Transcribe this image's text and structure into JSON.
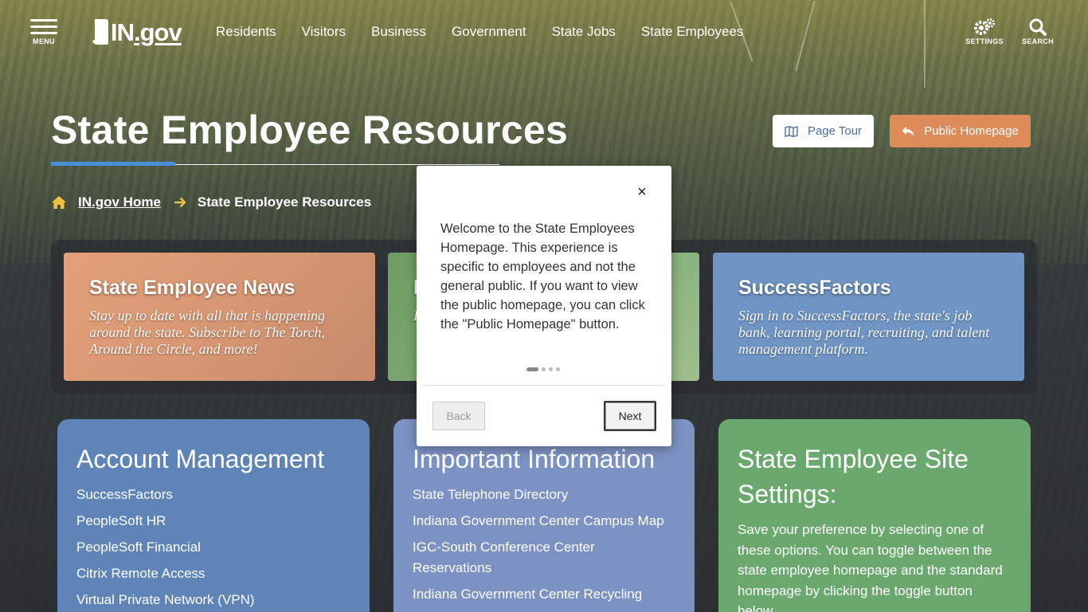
{
  "header": {
    "menu_label": "MENU",
    "logo_text_in": "IN",
    "logo_text_gov": ".gov",
    "nav": [
      "Residents",
      "Visitors",
      "Business",
      "Government",
      "State Jobs",
      "State Employees"
    ],
    "settings_label": "SETTINGS",
    "search_label": "SEARCH"
  },
  "hero": {
    "title": "State Employee Resources",
    "page_tour_label": "Page Tour",
    "public_homepage_label": "Public Homepage"
  },
  "breadcrumb": {
    "home": "IN.gov Home",
    "current": "State Employee Resources"
  },
  "features": [
    {
      "title": "State Employee News",
      "desc": "Stay up to date with all that is happening around the state. Subscribe to The Torch, Around the Circle, and more!"
    },
    {
      "title": "I",
      "desc": "L"
    },
    {
      "title": "SuccessFactors",
      "desc": "Sign in to SuccessFactors, the state's job bank, learning portal, recruiting, and talent management platform."
    }
  ],
  "account": {
    "title": "Account Management",
    "links": [
      "SuccessFactors",
      "PeopleSoft HR",
      "PeopleSoft Financial",
      "Citrix Remote Access",
      "Virtual Private Network (VPN)"
    ]
  },
  "important": {
    "title": "Important Information",
    "links": [
      "State Telephone Directory",
      "Indiana Government Center Campus Map",
      "IGC-South Conference Center Reservations",
      "Indiana Government Center Recycling"
    ]
  },
  "settings_card": {
    "title": "State Employee Site Settings:",
    "body": "Save your preference by selecting one of these options. You can toggle between the state employee homepage and the standard homepage by clicking the toggle button below."
  },
  "tour": {
    "close_glyph": "×",
    "text": "Welcome to the State Employees Homepage. This experience is specific to employees and not the general public. If you want to view the public homepage, you can click the \"Public Homepage\" button.",
    "back_label": "Back",
    "next_label": "Next",
    "step_count": 4,
    "active_step": 1
  },
  "colors": {
    "accent_blue": "#4a90d9",
    "public_btn": "#de8b5a",
    "news_card": "#d79772",
    "success_card": "#6f95c4",
    "account_card": "#5f85b8",
    "important_card": "#7b92c2",
    "settings_card": "#6aa86e"
  },
  "icons": [
    "menu-icon",
    "gear-icon",
    "search-icon",
    "map-icon",
    "reply-arrow-icon",
    "home-icon",
    "arrow-right-icon",
    "close-icon"
  ]
}
